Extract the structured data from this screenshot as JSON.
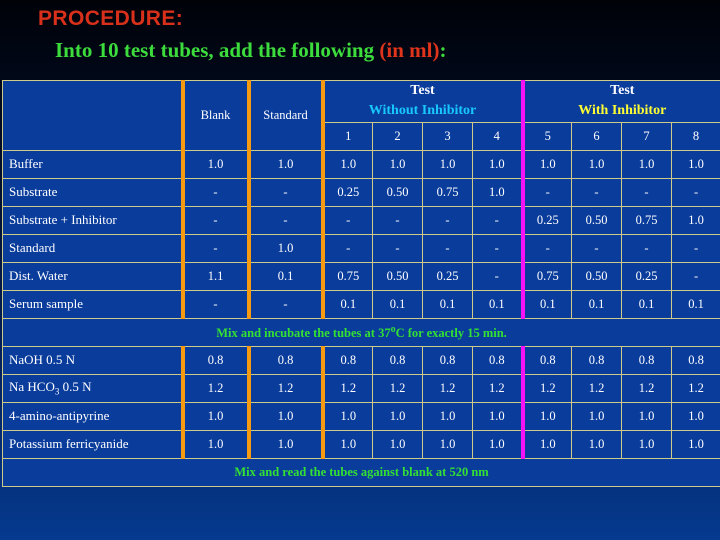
{
  "title": {
    "line1": "PROCEDURE:",
    "line2_pre": "Into 10 test tubes, add the following ",
    "line2_accent": "(in ml)",
    "line2_post": ":"
  },
  "table": {
    "header": {
      "blank": "Blank",
      "standard": "Standard",
      "group_left_main": "Test",
      "group_left_sub": "Without Inhibitor",
      "group_right_main": "Test",
      "group_right_sub": "With Inhibitor",
      "tube_numbers": [
        "1",
        "2",
        "3",
        "4",
        "5",
        "6",
        "7",
        "8"
      ]
    },
    "rows": [
      {
        "label": "Buffer",
        "label_color": "white",
        "value_color": "mixed",
        "values": [
          "1.0",
          "1.0",
          "1.0",
          "1.0",
          "1.0",
          "1.0",
          "1.0",
          "1.0",
          "1.0",
          "1.0"
        ]
      },
      {
        "label": "Substrate",
        "label_color": "cyan",
        "value_color": "mixed",
        "values": [
          "-",
          "-",
          "0.25",
          "0.50",
          "0.75",
          "1.0",
          "-",
          "-",
          "-",
          "-"
        ]
      },
      {
        "label": "Substrate + Inhibitor",
        "label_color": "yellow",
        "value_color": "mixed",
        "values": [
          "-",
          "-",
          "-",
          "-",
          "-",
          "-",
          "0.25",
          "0.50",
          "0.75",
          "1.0"
        ]
      },
      {
        "label": "Standard",
        "label_color": "white",
        "value_color": "mixed",
        "values": [
          "-",
          "1.0",
          "-",
          "-",
          "-",
          "-",
          "-",
          "-",
          "-",
          "-"
        ]
      },
      {
        "label": "Dist. Water",
        "label_color": "white",
        "value_color": "mixed",
        "values": [
          "1.1",
          "0.1",
          "0.75",
          "0.50",
          "0.25",
          "-",
          "0.75",
          "0.50",
          "0.25",
          "-"
        ]
      },
      {
        "label": "Serum sample",
        "label_color": "white",
        "value_color": "mixed",
        "values": [
          "-",
          "-",
          "0.1",
          "0.1",
          "0.1",
          "0.1",
          "0.1",
          "0.1",
          "0.1",
          "0.1"
        ]
      }
    ],
    "banner_mid_pre": "Mix and incubate the tubes at 37",
    "banner_mid_deg": "o",
    "banner_mid_post": "C for exactly 15 min.",
    "rows2": [
      {
        "label_pre": "NaOH   0.5 N",
        "label_sub": "",
        "label_post": "",
        "values": [
          "0.8",
          "0.8",
          "0.8",
          "0.8",
          "0.8",
          "0.8",
          "0.8",
          "0.8",
          "0.8",
          "0.8"
        ]
      },
      {
        "label_pre": "Na HCO",
        "label_sub": "3",
        "label_post": "  0.5 N",
        "values": [
          "1.2",
          "1.2",
          "1.2",
          "1.2",
          "1.2",
          "1.2",
          "1.2",
          "1.2",
          "1.2",
          "1.2"
        ]
      },
      {
        "label_pre": "4-amino-antipyrine",
        "label_sub": "",
        "label_post": "",
        "values": [
          "1.0",
          "1.0",
          "1.0",
          "1.0",
          "1.0",
          "1.0",
          "1.0",
          "1.0",
          "1.0",
          "1.0"
        ]
      },
      {
        "label_pre": "Potassium ferricyanide",
        "label_sub": "",
        "label_post": "",
        "values": [
          "1.0",
          "1.0",
          "1.0",
          "1.0",
          "1.0",
          "1.0",
          "1.0",
          "1.0",
          "1.0",
          "1.0"
        ]
      }
    ],
    "banner_bottom": "Mix and read the tubes against blank at 520 nm"
  },
  "colors": {
    "title_red": "#d8301b",
    "title_green": "#3ddc3d",
    "cell_bg": "#0a3c9c",
    "border": "#cfc98a",
    "separator_orange": "#f59a11",
    "separator_magenta": "#f612f6",
    "banner_green": "#33e033",
    "header_cyan": "#19c8ff",
    "header_yellow": "#ffff33"
  }
}
